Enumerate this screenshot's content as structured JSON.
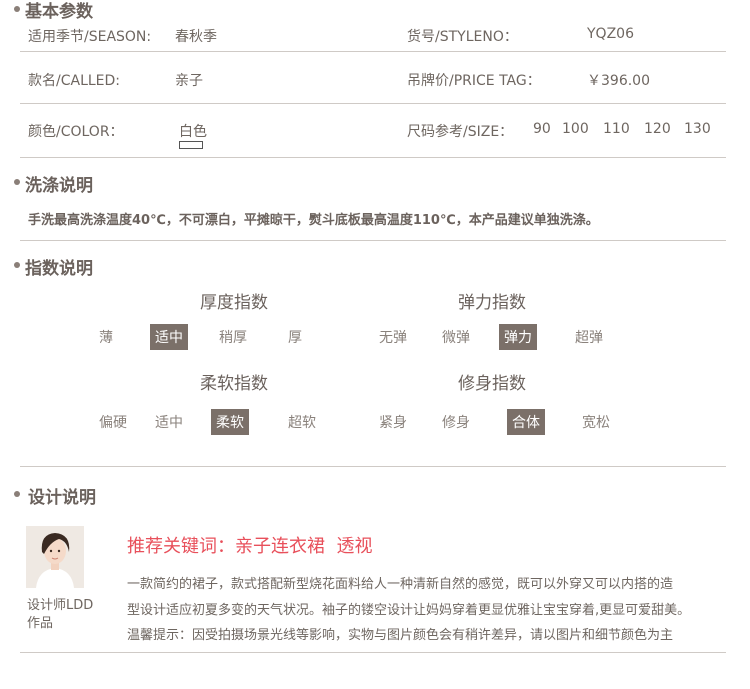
{
  "basic_params": {
    "title": "基本参数",
    "season_label": "适用季节/SEASON:",
    "season_value": "春秋季",
    "styleno_label": "货号/STYLENO：",
    "styleno_value": "YQZ06",
    "called_label": "款名/CALLED:",
    "called_value": "亲子",
    "price_label": "吊牌价/PRICE TAG：",
    "price_value": "￥396.00",
    "color_label": "颜色/COLOR：",
    "color_value": "白色",
    "size_label": "尺码参考/SIZE：",
    "sizes": [
      "90",
      "100",
      "110",
      "120",
      "130"
    ]
  },
  "wash": {
    "title": "洗涤说明",
    "text": "手洗最高洗涤温度40℃，不可漂白，平摊晾干，熨斗底板最高温度110℃，本产品建议单独洗涤。"
  },
  "index": {
    "title": "指数说明",
    "thickness": {
      "title": "厚度指数",
      "options": [
        "薄",
        "适中",
        "稍厚",
        "厚"
      ],
      "selected": "适中"
    },
    "elasticity": {
      "title": "弹力指数",
      "options": [
        "无弹",
        "微弹",
        "弹力",
        "超弹"
      ],
      "selected": "弹力"
    },
    "softness": {
      "title": "柔软指数",
      "options": [
        "偏硬",
        "适中",
        "柔软",
        "超软"
      ],
      "selected": "柔软"
    },
    "fit": {
      "title": "修身指数",
      "options": [
        "紧身",
        "修身",
        "合体",
        "宽松"
      ],
      "selected": "合体"
    }
  },
  "design": {
    "title": "设计说明",
    "designer_caption_1": "设计师LDD",
    "designer_caption_2": "作品",
    "keywords": "推荐关键词：亲子连衣裙  透视",
    "desc_line1": "一款简约的裙子，款式搭配新型烧花面料给人一种清新自然的感觉，既可以外穿又可以内搭的造",
    "desc_line2": "型设计适应初夏多变的天气状况。袖子的镂空设计让妈妈穿着更显优雅让宝宝穿着,更显可爱甜美。",
    "desc_line3": "温馨提示：因受拍摄场景光线等影响，实物与图片颜色会有稍许差异，请以图片和细节颜色为主"
  },
  "colors": {
    "accent_keyword": "#e8505b",
    "selected_bg": "#7b7069"
  }
}
